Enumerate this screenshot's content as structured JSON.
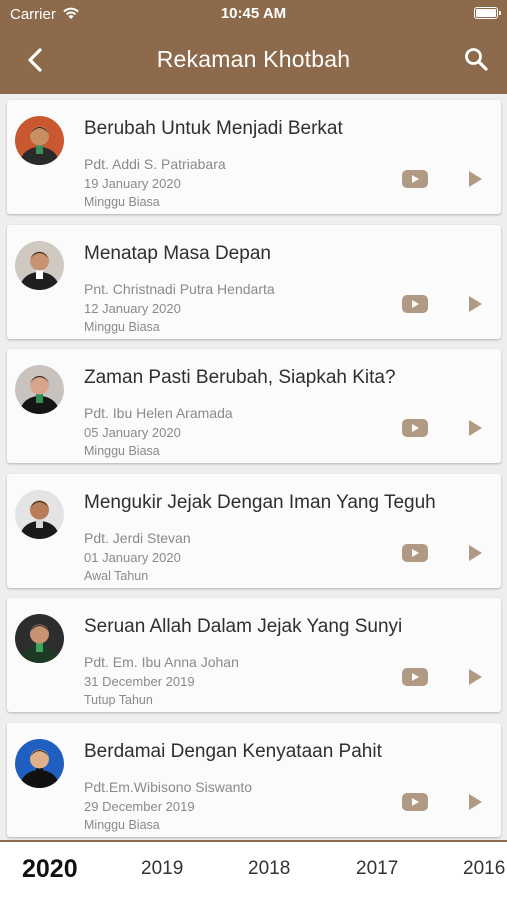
{
  "status_bar": {
    "carrier": "Carrier",
    "time": "10:45 AM"
  },
  "header": {
    "title": "Rekaman Khotbah"
  },
  "sermons": [
    {
      "title": "Berubah Untuk Menjadi Berkat",
      "speaker": "Pdt. Addi S. Patriabara",
      "date": "19 January 2020",
      "occasion": "Minggu Biasa"
    },
    {
      "title": "Menatap Masa Depan",
      "speaker": "Pnt. Christnadi Putra Hendarta",
      "date": "12 January 2020",
      "occasion": "Minggu Biasa"
    },
    {
      "title": "Zaman Pasti Berubah, Siapkah Kita?",
      "speaker": "Pdt. Ibu Helen Aramada",
      "date": "05 January 2020",
      "occasion": "Minggu Biasa"
    },
    {
      "title": "Mengukir Jejak Dengan Iman Yang Teguh",
      "speaker": "Pdt. Jerdi Stevan",
      "date": "01 January 2020",
      "occasion": "Awal Tahun"
    },
    {
      "title": "Seruan Allah Dalam Jejak Yang Sunyi",
      "speaker": "Pdt. Em. Ibu Anna Johan",
      "date": "31 December 2019",
      "occasion": "Tutup Tahun"
    },
    {
      "title": "Berdamai Dengan Kenyataan Pahit",
      "speaker": "Pdt.Em.Wibisono Siswanto",
      "date": "29 December 2019",
      "occasion": "Minggu Biasa"
    }
  ],
  "year_tabs": [
    "2020",
    "2019",
    "2018",
    "2017",
    "2016"
  ],
  "active_year": "2020",
  "colors": {
    "brand": "#8c6a4b",
    "icon": "#b09a84"
  },
  "icons": {
    "back": "chevron-left-icon",
    "search": "search-icon",
    "video": "youtube-icon",
    "audio": "play-icon"
  }
}
